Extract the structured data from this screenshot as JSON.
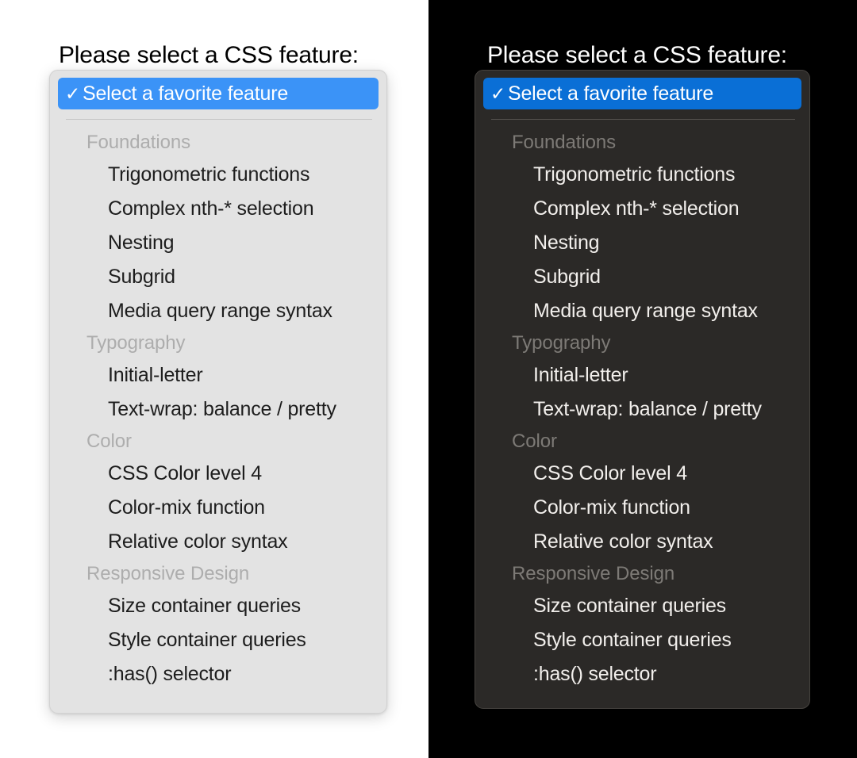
{
  "panels": [
    {
      "theme": "light",
      "prompt": "Please select a CSS feature:",
      "selected_option": {
        "label": "Select a favorite feature",
        "icon": "checkmark-icon",
        "check_glyph": "✓",
        "selected": true
      },
      "accent_color": "#3b93f7",
      "panel_background": "#e3e3e3",
      "page_background": "#ffffff",
      "text_color": "#1d1d1d",
      "group_label_color": "#adadad",
      "groups": [
        {
          "label": "Foundations",
          "options": [
            "Trigonometric functions",
            "Complex nth-* selection",
            "Nesting",
            "Subgrid",
            "Media query range syntax"
          ]
        },
        {
          "label": "Typography",
          "options": [
            "Initial-letter",
            "Text-wrap: balance / pretty"
          ]
        },
        {
          "label": "Color",
          "options": [
            "CSS Color level 4",
            "Color-mix function",
            "Relative color syntax"
          ]
        },
        {
          "label": "Responsive Design",
          "options": [
            "Size container queries",
            "Style container queries",
            ":has() selector"
          ]
        }
      ]
    },
    {
      "theme": "dark",
      "prompt": "Please select a CSS feature:",
      "selected_option": {
        "label": "Select a favorite feature",
        "icon": "checkmark-icon",
        "check_glyph": "✓",
        "selected": true
      },
      "accent_color": "#0a6fd6",
      "panel_background": "#2b2927",
      "page_background": "#000000",
      "text_color": "#f2efec",
      "group_label_color": "#7d7a76",
      "groups": [
        {
          "label": "Foundations",
          "options": [
            "Trigonometric functions",
            "Complex nth-* selection",
            "Nesting",
            "Subgrid",
            "Media query range syntax"
          ]
        },
        {
          "label": "Typography",
          "options": [
            "Initial-letter",
            "Text-wrap: balance / pretty"
          ]
        },
        {
          "label": "Color",
          "options": [
            "CSS Color level 4",
            "Color-mix function",
            "Relative color syntax"
          ]
        },
        {
          "label": "Responsive Design",
          "options": [
            "Size container queries",
            "Style container queries",
            ":has() selector"
          ]
        }
      ]
    }
  ]
}
